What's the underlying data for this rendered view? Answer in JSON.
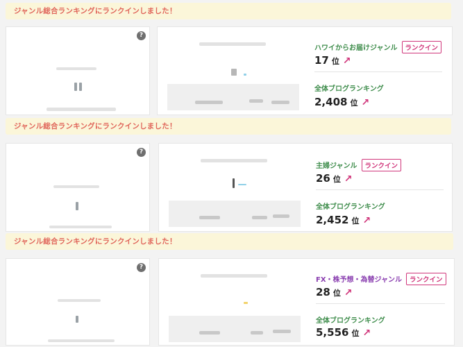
{
  "blocks": [
    {
      "banner": "ジャンル総合ランキングにランクインしました！",
      "help_icon": "?",
      "genre": "ハワイからお届けジャンル",
      "badge": "ランクイン",
      "genre_rank": "17",
      "unit": "位",
      "arrow": "↗",
      "overall_label": "全体ブログランキング",
      "overall_rank": "2,408",
      "dot_color": "#8fd0e8"
    },
    {
      "banner": "ジャンル総合ランキングにランクインしました！",
      "help_icon": "?",
      "genre": "主婦ジャンル",
      "badge": "ランクイン",
      "genre_rank": "26",
      "unit": "位",
      "arrow": "↗",
      "overall_label": "全体ブログランキング",
      "overall_rank": "2,452",
      "dot_color": "#8fd0e8"
    },
    {
      "banner": "ジャンル総合ランキングにランクインしました！",
      "help_icon": "?",
      "genre": "FX・株予想・為替ジャンル",
      "badge": "ランクイン",
      "genre_rank": "28",
      "unit": "位",
      "arrow": "↗",
      "overall_label": "全体ブログランキング",
      "overall_rank": "5,556",
      "dot_color": "#f2d36b"
    }
  ],
  "colors": {
    "banner_bg": "#fbf6d9",
    "banner_text": "#e0655a",
    "genre_text": "#3f8d4c",
    "badge": "#d0357a"
  },
  "icons": {
    "help": "help-circle-icon",
    "trend": "arrow-up-right-icon"
  }
}
